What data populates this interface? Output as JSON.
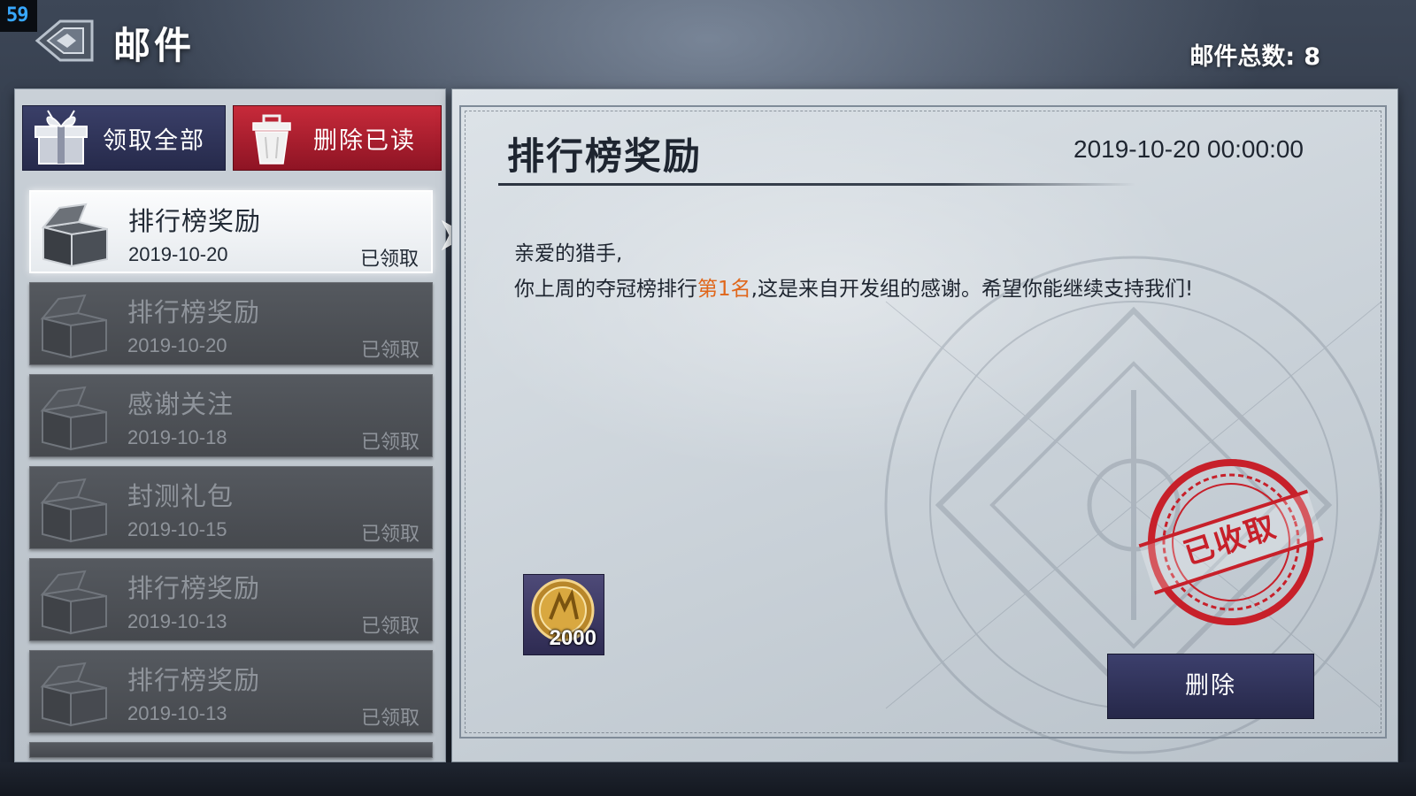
{
  "fps": "59",
  "header": {
    "title": "邮件",
    "mail_total_label": "邮件总数:",
    "mail_total_value": "8"
  },
  "toolbar": {
    "claim_all_label": "领取全部",
    "delete_read_label": "删除已读"
  },
  "mail_list": [
    {
      "subject": "排行榜奖励",
      "date": "2019-10-20",
      "status": "已领取",
      "selected": true
    },
    {
      "subject": "排行榜奖励",
      "date": "2019-10-20",
      "status": "已领取",
      "selected": false
    },
    {
      "subject": "感谢关注",
      "date": "2019-10-18",
      "status": "已领取",
      "selected": false
    },
    {
      "subject": "封测礼包",
      "date": "2019-10-15",
      "status": "已领取",
      "selected": false
    },
    {
      "subject": "排行榜奖励",
      "date": "2019-10-13",
      "status": "已领取",
      "selected": false
    },
    {
      "subject": "排行榜奖励",
      "date": "2019-10-13",
      "status": "已领取",
      "selected": false
    }
  ],
  "detail": {
    "title": "排行榜奖励",
    "datetime": "2019-10-20 00:00:00",
    "greeting": "亲爱的猎手,",
    "body_prefix": "你上周的夺冠榜排行",
    "rank_text": "第1名",
    "body_suffix": ",这是来自开发组的感谢。希望你能继续支持我们!",
    "reward": {
      "icon": "gold-coin-icon",
      "quantity": "2000"
    },
    "stamp_text": "已收取",
    "delete_label": "删除"
  },
  "colors": {
    "accent_navy": "#2b2e55",
    "delete_red": "#b41f30",
    "highlight_orange": "#e0661a",
    "stamp_red": "#c7202a"
  }
}
